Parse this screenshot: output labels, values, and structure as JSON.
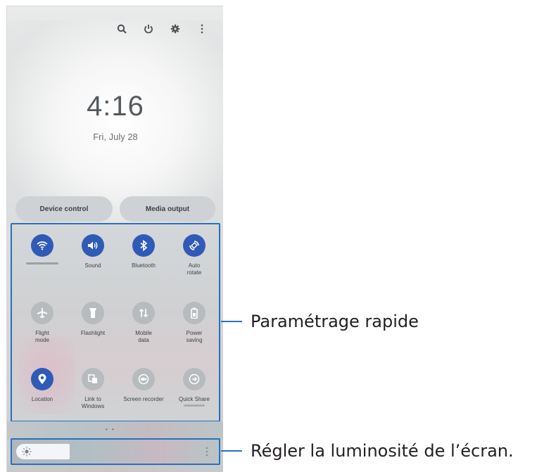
{
  "lockscreen": {
    "time": "4:16",
    "date": "Fri, July 28",
    "top_icons": [
      "search-icon",
      "power-icon",
      "gear-icon",
      "more-vert-icon"
    ]
  },
  "shortcuts": {
    "device_control": "Device control",
    "media_output": "Media output"
  },
  "quick_settings": [
    {
      "label": "",
      "icon": "wifi-icon",
      "state": "on"
    },
    {
      "label": "Sound",
      "icon": "sound-icon",
      "state": "on"
    },
    {
      "label": "Bluetooth",
      "icon": "bluetooth-icon",
      "state": "on"
    },
    {
      "label": "Auto rotate",
      "icon": "auto-rotate-icon",
      "state": "on"
    },
    {
      "label": "Flight mode",
      "icon": "airplane-icon",
      "state": "off"
    },
    {
      "label": "Flashlight",
      "icon": "flashlight-icon",
      "state": "off"
    },
    {
      "label": "Mobile data",
      "icon": "mobile-data-icon",
      "state": "off"
    },
    {
      "label": "Power saving",
      "icon": "battery-icon",
      "state": "off"
    },
    {
      "label": "Location",
      "icon": "location-icon",
      "state": "on"
    },
    {
      "label": "Link to Windows",
      "icon": "link-windows-icon",
      "state": "off"
    },
    {
      "label": "Screen recorder",
      "icon": "screen-recorder-icon",
      "state": "off"
    },
    {
      "label": "Quick Share",
      "icon": "quick-share-icon",
      "state": "off"
    }
  ],
  "page_indicator": "• •",
  "brightness": {
    "level": 0.27
  },
  "callouts": {
    "quick_settings": "Paramétrage rapide",
    "brightness": "Régler la luminosité de l’écran."
  },
  "colors": {
    "accent": "#2a6fbf",
    "tile_on": "#2f5bb7",
    "tile_off": "#b7bbbe"
  }
}
